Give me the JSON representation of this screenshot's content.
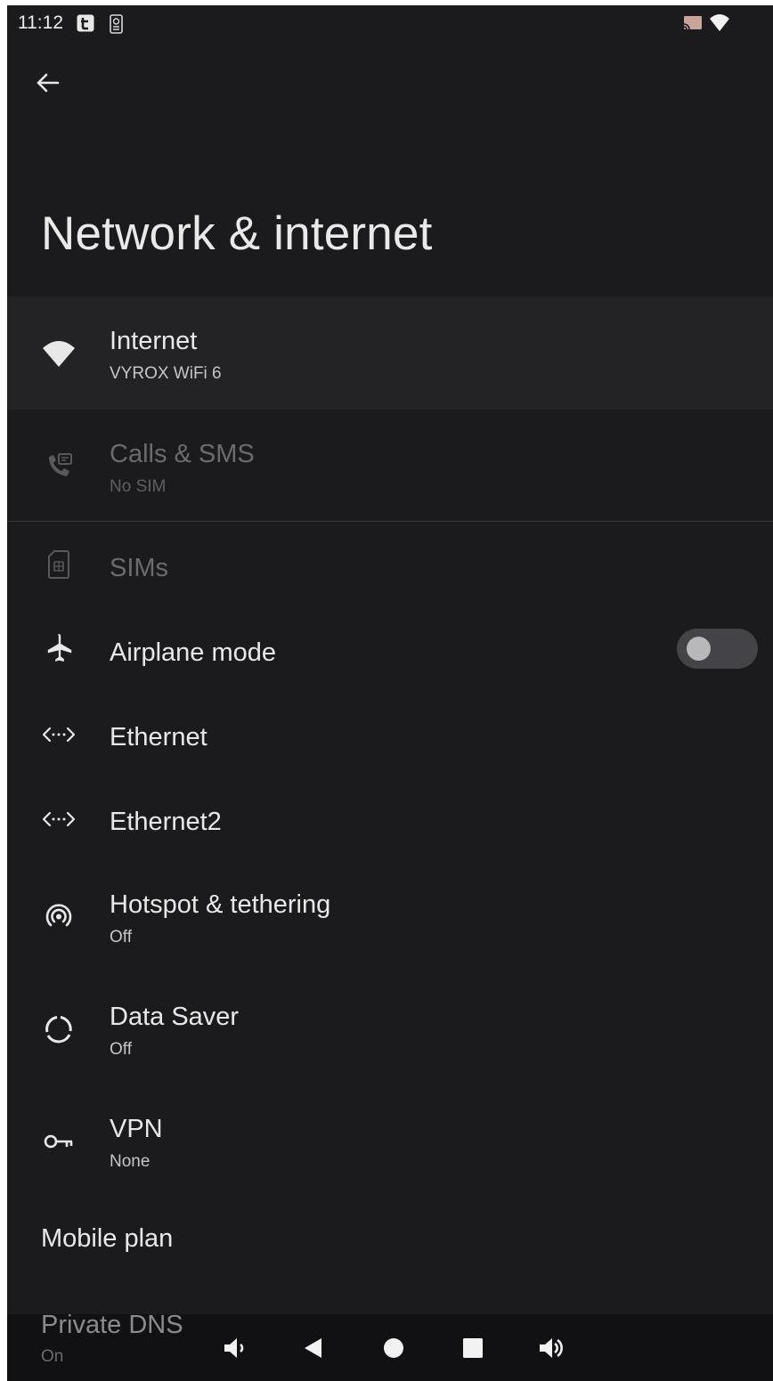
{
  "status_bar": {
    "time": "11:12",
    "left_icons": [
      "app-notification-icon",
      "app-notification-icon-2"
    ],
    "right_icons": [
      "cast-icon",
      "wifi-signal-icon"
    ]
  },
  "header": {
    "back_icon": "back-arrow-icon",
    "title": "Network & internet"
  },
  "items": [
    {
      "icon": "wifi-icon",
      "title": "Internet",
      "subtitle": "VYROX WiFi 6",
      "enabled": true,
      "highlighted": true
    },
    {
      "icon": "calls-sms-icon",
      "title": "Calls & SMS",
      "subtitle": "No SIM",
      "enabled": false
    },
    {
      "icon": "sim-card-icon",
      "title": "SIMs",
      "enabled": false
    },
    {
      "icon": "airplane-icon",
      "title": "Airplane mode",
      "toggle": "off",
      "enabled": true
    },
    {
      "icon": "ethernet-icon",
      "title": "Ethernet",
      "enabled": true
    },
    {
      "icon": "ethernet-icon",
      "title": "Ethernet2",
      "enabled": true
    },
    {
      "icon": "hotspot-icon",
      "title": "Hotspot & tethering",
      "subtitle": "Off",
      "enabled": true
    },
    {
      "icon": "data-saver-icon",
      "title": "Data Saver",
      "subtitle": "Off",
      "enabled": true
    },
    {
      "icon": "vpn-key-icon",
      "title": "VPN",
      "subtitle": "None",
      "enabled": true
    }
  ],
  "mobile_plan": {
    "title": "Mobile plan"
  },
  "private_dns": {
    "title": "Private DNS",
    "subtitle": "On"
  },
  "nav_bar": {
    "buttons": [
      "volume-down-icon",
      "back-triangle-icon",
      "home-circle-icon",
      "recents-square-icon",
      "volume-up-icon"
    ]
  },
  "colors": {
    "background": "#1b1b1d",
    "highlight_row": "#232326",
    "text_primary": "#e8e8e8",
    "text_disabled": "#6b6b6d",
    "nav_bar": "#111113"
  }
}
